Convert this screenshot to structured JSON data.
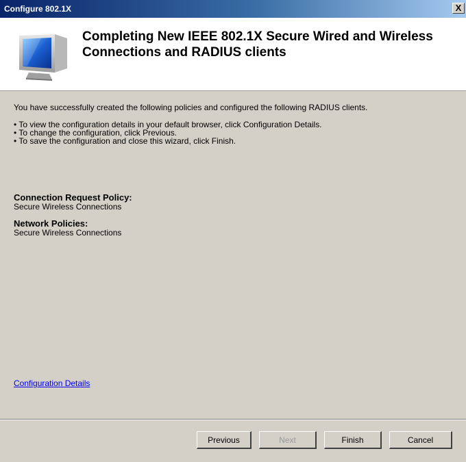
{
  "window": {
    "title": "Configure 802.1X",
    "close_label": "X"
  },
  "header": {
    "title": "Completing New IEEE 802.1X Secure Wired and Wireless Connections and RADIUS clients",
    "icon": "monitor-icon"
  },
  "intro": "You have successfully created the following policies and configured the following RADIUS clients.",
  "instructions": [
    "• To view the configuration details in your default browser, click Configuration Details.",
    "• To change the configuration, click Previous.",
    "• To save the configuration and close this wizard, click Finish."
  ],
  "summary": {
    "connection_request_policy_label": "Connection Request Policy:",
    "connection_request_policy_value": "Secure Wireless Connections",
    "network_policies_label": "Network Policies:",
    "network_policies_value": "Secure Wireless Connections"
  },
  "config_details_link": "Configuration Details",
  "buttons": {
    "previous": "Previous",
    "next": "Next",
    "finish": "Finish",
    "cancel": "Cancel"
  }
}
